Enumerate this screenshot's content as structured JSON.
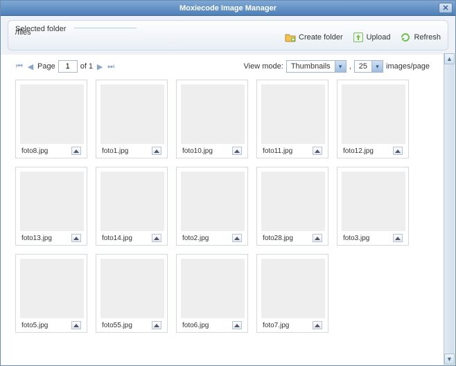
{
  "window": {
    "title": "Moxiecode Image Manager"
  },
  "toolbar": {
    "selected_folder_label": "Selected folder",
    "path": "/files",
    "create_folder": "Create folder",
    "upload": "Upload",
    "refresh": "Refresh"
  },
  "pager": {
    "page_label": "Page",
    "page_value": "1",
    "of_label": "of 1"
  },
  "viewmode": {
    "label": "View mode:",
    "mode": "Thumbnails",
    "comma": ",",
    "per_page": "25",
    "suffix": "images/page"
  },
  "thumbs": [
    {
      "file": "foto8.jpg",
      "cls": "p1"
    },
    {
      "file": "foto1.jpg",
      "cls": "p2"
    },
    {
      "file": "foto10.jpg",
      "cls": "p3"
    },
    {
      "file": "foto11.jpg",
      "cls": "p4"
    },
    {
      "file": "foto12.jpg",
      "cls": "p5"
    },
    {
      "file": "foto13.jpg",
      "cls": "p6"
    },
    {
      "file": "foto14.jpg",
      "cls": "p7"
    },
    {
      "file": "foto2.jpg",
      "cls": "p8"
    },
    {
      "file": "foto28.jpg",
      "cls": "p9"
    },
    {
      "file": "foto3.jpg",
      "cls": "p10"
    },
    {
      "file": "foto5.jpg",
      "cls": "p11"
    },
    {
      "file": "foto55.jpg",
      "cls": "p12"
    },
    {
      "file": "foto6.jpg",
      "cls": "p13"
    },
    {
      "file": "foto7.jpg",
      "cls": "p14"
    }
  ]
}
